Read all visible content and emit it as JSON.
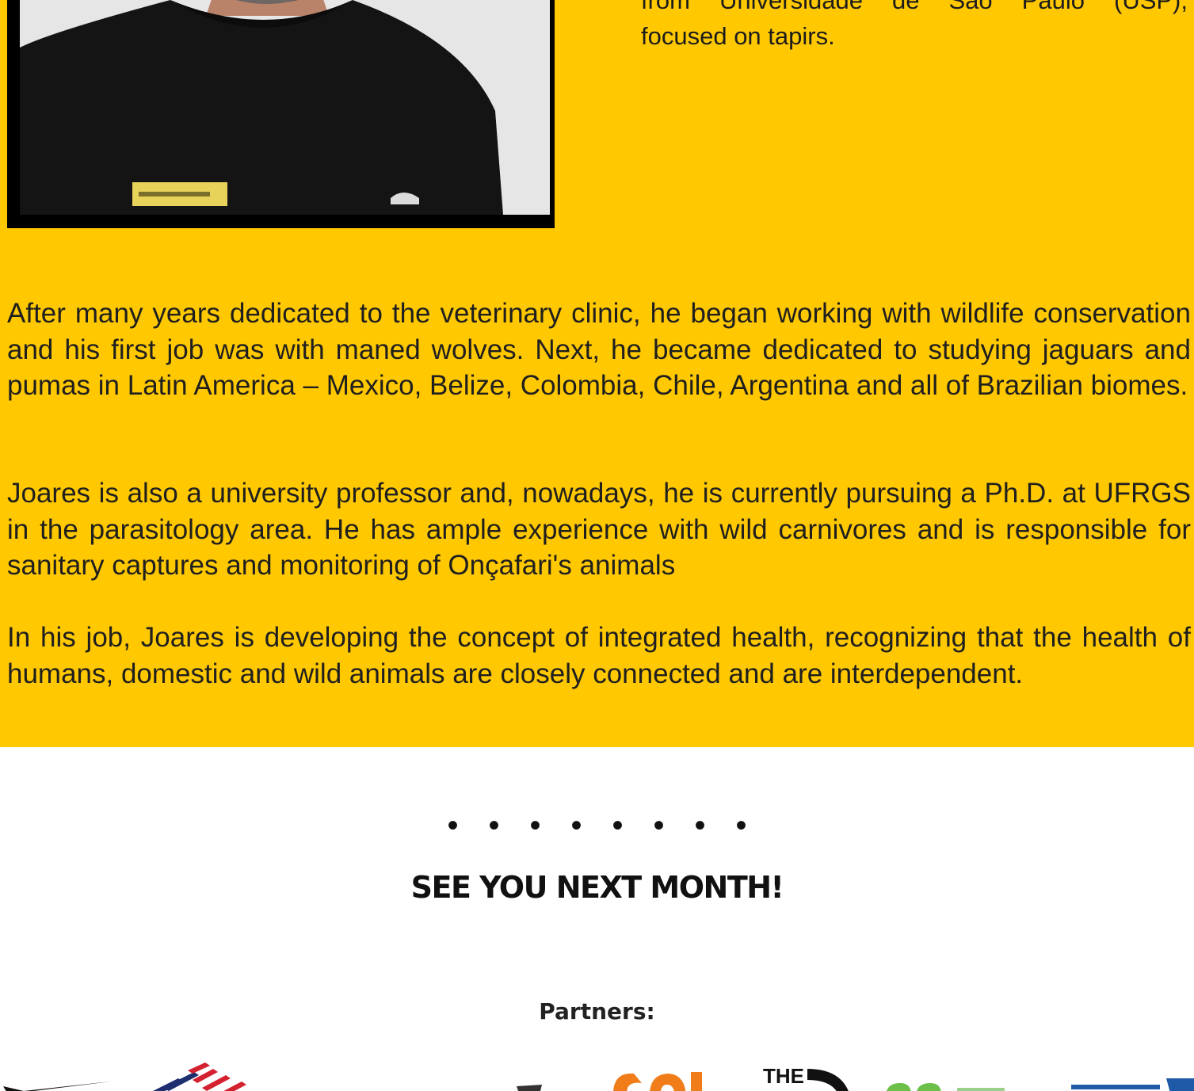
{
  "profile": {
    "intro_line1": "from Universidade de São Paulo (USP),",
    "intro_line2": "focused on tapirs."
  },
  "bio": {
    "paragraphs": [
      "After many years dedicated to the veterinary clinic, he began working with wildlife conservation and his first job was with maned wolves. Next, he became dedicated to studying jaguars and pumas in Latin America – Mexico, Belize, Colombia, Chile, Argentina and all of Brazilian biomes.",
      "Joares is also a university professor and, nowadays, he is currently pursuing a Ph.D. at UFRGS in the parasitology area. He has ample experience with wild carnivores and is responsible for sanitary captures and monitoring of Onçafari's animals",
      "In his job, Joares is developing the concept of integrated health, recognizing that the health of humans, domestic and wild animals are closely connected and are interdependent."
    ]
  },
  "footer": {
    "dots": "••••••••",
    "closing": "SEE YOU NEXT MONTH!",
    "partners_label": "Partners:"
  },
  "logos": {
    "colors": {
      "orange": "#f07d1a",
      "green": "#6cc04a",
      "blue": "#1f5aa8",
      "red": "#d3212f",
      "navy": "#1d2f6f"
    },
    "items": [
      "swoosh-logo",
      "bank-stripes-logo",
      "orange-partner-logo",
      "the-north-face-logo",
      "green-partner-logo",
      "united-partner-logo"
    ],
    "north_face_text": "THE"
  }
}
